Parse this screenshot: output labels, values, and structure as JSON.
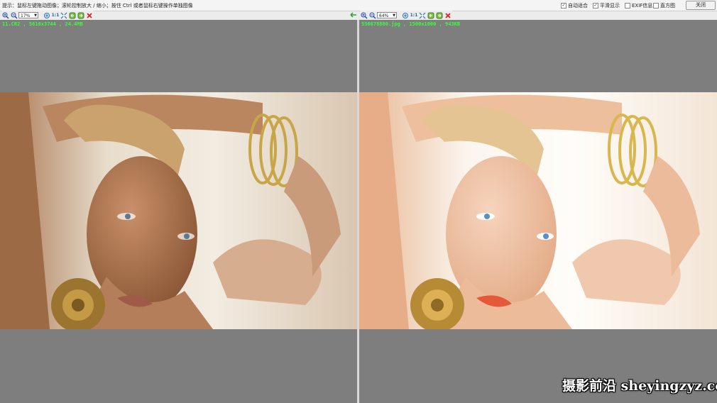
{
  "hint": "提示：鼠标左键拖动图像；滚轮控制放大 / 缩小；按住 Ctrl 或者鼠标右键操作单独图像",
  "options": [
    {
      "label": "自动适合",
      "checked": true
    },
    {
      "label": "平滑显示",
      "checked": true
    },
    {
      "label": "EXIF信息",
      "checked": false
    },
    {
      "label": "直方图",
      "checked": false
    }
  ],
  "close_label": "关闭",
  "left": {
    "zoom": "17%",
    "info": "11.CR2 , 5616x3744 , 24.4MB"
  },
  "right": {
    "zoom": "64%",
    "info": "556678880.jpg , 1500x1000 , 943KB"
  },
  "one_to_one": "1:1",
  "watermark": "摄影前沿 sheyingzyz.com"
}
